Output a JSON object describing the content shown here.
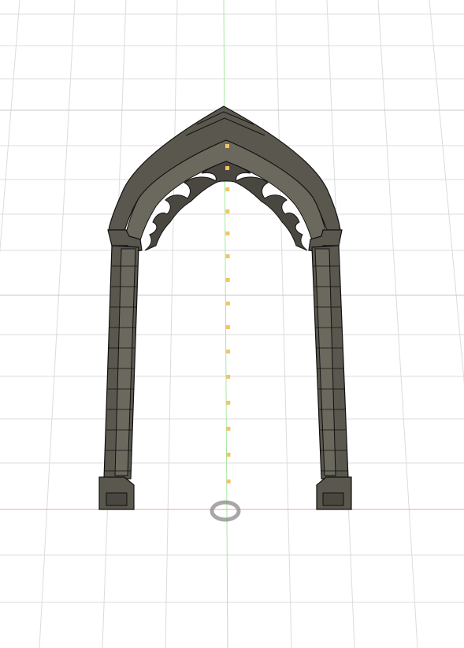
{
  "viewport": {
    "background": "#ffffff",
    "grid_color": "#dcdcdc",
    "grid_major_color": "#c8c8c8",
    "x_axis_color": "#f0a0a8",
    "y_axis_color": "#a8e8a0",
    "guide_color": "#f2c46a"
  },
  "model": {
    "name": "gothic-arch",
    "fill": "#5a574e",
    "fill_light": "#6b685e",
    "fill_dark": "#4a4740",
    "stroke": "#111111"
  },
  "origin_marker": {
    "color": "#8a8a8a"
  }
}
